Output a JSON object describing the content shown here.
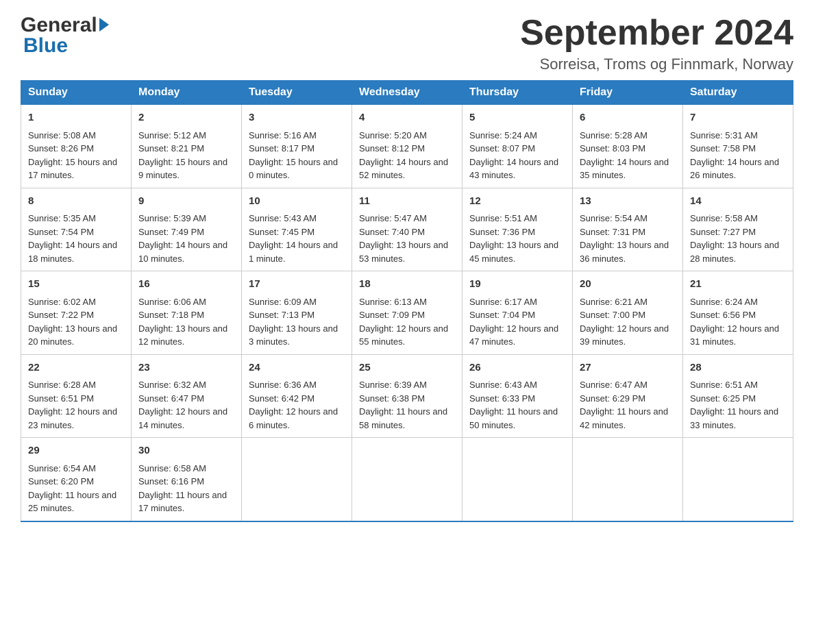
{
  "header": {
    "logo_general": "General",
    "logo_blue": "Blue",
    "month_title": "September 2024",
    "subtitle": "Sorreisa, Troms og Finnmark, Norway"
  },
  "days_of_week": [
    "Sunday",
    "Monday",
    "Tuesday",
    "Wednesday",
    "Thursday",
    "Friday",
    "Saturday"
  ],
  "weeks": [
    [
      {
        "day": "1",
        "sunrise": "Sunrise: 5:08 AM",
        "sunset": "Sunset: 8:26 PM",
        "daylight": "Daylight: 15 hours and 17 minutes."
      },
      {
        "day": "2",
        "sunrise": "Sunrise: 5:12 AM",
        "sunset": "Sunset: 8:21 PM",
        "daylight": "Daylight: 15 hours and 9 minutes."
      },
      {
        "day": "3",
        "sunrise": "Sunrise: 5:16 AM",
        "sunset": "Sunset: 8:17 PM",
        "daylight": "Daylight: 15 hours and 0 minutes."
      },
      {
        "day": "4",
        "sunrise": "Sunrise: 5:20 AM",
        "sunset": "Sunset: 8:12 PM",
        "daylight": "Daylight: 14 hours and 52 minutes."
      },
      {
        "day": "5",
        "sunrise": "Sunrise: 5:24 AM",
        "sunset": "Sunset: 8:07 PM",
        "daylight": "Daylight: 14 hours and 43 minutes."
      },
      {
        "day": "6",
        "sunrise": "Sunrise: 5:28 AM",
        "sunset": "Sunset: 8:03 PM",
        "daylight": "Daylight: 14 hours and 35 minutes."
      },
      {
        "day": "7",
        "sunrise": "Sunrise: 5:31 AM",
        "sunset": "Sunset: 7:58 PM",
        "daylight": "Daylight: 14 hours and 26 minutes."
      }
    ],
    [
      {
        "day": "8",
        "sunrise": "Sunrise: 5:35 AM",
        "sunset": "Sunset: 7:54 PM",
        "daylight": "Daylight: 14 hours and 18 minutes."
      },
      {
        "day": "9",
        "sunrise": "Sunrise: 5:39 AM",
        "sunset": "Sunset: 7:49 PM",
        "daylight": "Daylight: 14 hours and 10 minutes."
      },
      {
        "day": "10",
        "sunrise": "Sunrise: 5:43 AM",
        "sunset": "Sunset: 7:45 PM",
        "daylight": "Daylight: 14 hours and 1 minute."
      },
      {
        "day": "11",
        "sunrise": "Sunrise: 5:47 AM",
        "sunset": "Sunset: 7:40 PM",
        "daylight": "Daylight: 13 hours and 53 minutes."
      },
      {
        "day": "12",
        "sunrise": "Sunrise: 5:51 AM",
        "sunset": "Sunset: 7:36 PM",
        "daylight": "Daylight: 13 hours and 45 minutes."
      },
      {
        "day": "13",
        "sunrise": "Sunrise: 5:54 AM",
        "sunset": "Sunset: 7:31 PM",
        "daylight": "Daylight: 13 hours and 36 minutes."
      },
      {
        "day": "14",
        "sunrise": "Sunrise: 5:58 AM",
        "sunset": "Sunset: 7:27 PM",
        "daylight": "Daylight: 13 hours and 28 minutes."
      }
    ],
    [
      {
        "day": "15",
        "sunrise": "Sunrise: 6:02 AM",
        "sunset": "Sunset: 7:22 PM",
        "daylight": "Daylight: 13 hours and 20 minutes."
      },
      {
        "day": "16",
        "sunrise": "Sunrise: 6:06 AM",
        "sunset": "Sunset: 7:18 PM",
        "daylight": "Daylight: 13 hours and 12 minutes."
      },
      {
        "day": "17",
        "sunrise": "Sunrise: 6:09 AM",
        "sunset": "Sunset: 7:13 PM",
        "daylight": "Daylight: 13 hours and 3 minutes."
      },
      {
        "day": "18",
        "sunrise": "Sunrise: 6:13 AM",
        "sunset": "Sunset: 7:09 PM",
        "daylight": "Daylight: 12 hours and 55 minutes."
      },
      {
        "day": "19",
        "sunrise": "Sunrise: 6:17 AM",
        "sunset": "Sunset: 7:04 PM",
        "daylight": "Daylight: 12 hours and 47 minutes."
      },
      {
        "day": "20",
        "sunrise": "Sunrise: 6:21 AM",
        "sunset": "Sunset: 7:00 PM",
        "daylight": "Daylight: 12 hours and 39 minutes."
      },
      {
        "day": "21",
        "sunrise": "Sunrise: 6:24 AM",
        "sunset": "Sunset: 6:56 PM",
        "daylight": "Daylight: 12 hours and 31 minutes."
      }
    ],
    [
      {
        "day": "22",
        "sunrise": "Sunrise: 6:28 AM",
        "sunset": "Sunset: 6:51 PM",
        "daylight": "Daylight: 12 hours and 23 minutes."
      },
      {
        "day": "23",
        "sunrise": "Sunrise: 6:32 AM",
        "sunset": "Sunset: 6:47 PM",
        "daylight": "Daylight: 12 hours and 14 minutes."
      },
      {
        "day": "24",
        "sunrise": "Sunrise: 6:36 AM",
        "sunset": "Sunset: 6:42 PM",
        "daylight": "Daylight: 12 hours and 6 minutes."
      },
      {
        "day": "25",
        "sunrise": "Sunrise: 6:39 AM",
        "sunset": "Sunset: 6:38 PM",
        "daylight": "Daylight: 11 hours and 58 minutes."
      },
      {
        "day": "26",
        "sunrise": "Sunrise: 6:43 AM",
        "sunset": "Sunset: 6:33 PM",
        "daylight": "Daylight: 11 hours and 50 minutes."
      },
      {
        "day": "27",
        "sunrise": "Sunrise: 6:47 AM",
        "sunset": "Sunset: 6:29 PM",
        "daylight": "Daylight: 11 hours and 42 minutes."
      },
      {
        "day": "28",
        "sunrise": "Sunrise: 6:51 AM",
        "sunset": "Sunset: 6:25 PM",
        "daylight": "Daylight: 11 hours and 33 minutes."
      }
    ],
    [
      {
        "day": "29",
        "sunrise": "Sunrise: 6:54 AM",
        "sunset": "Sunset: 6:20 PM",
        "daylight": "Daylight: 11 hours and 25 minutes."
      },
      {
        "day": "30",
        "sunrise": "Sunrise: 6:58 AM",
        "sunset": "Sunset: 6:16 PM",
        "daylight": "Daylight: 11 hours and 17 minutes."
      },
      null,
      null,
      null,
      null,
      null
    ]
  ]
}
